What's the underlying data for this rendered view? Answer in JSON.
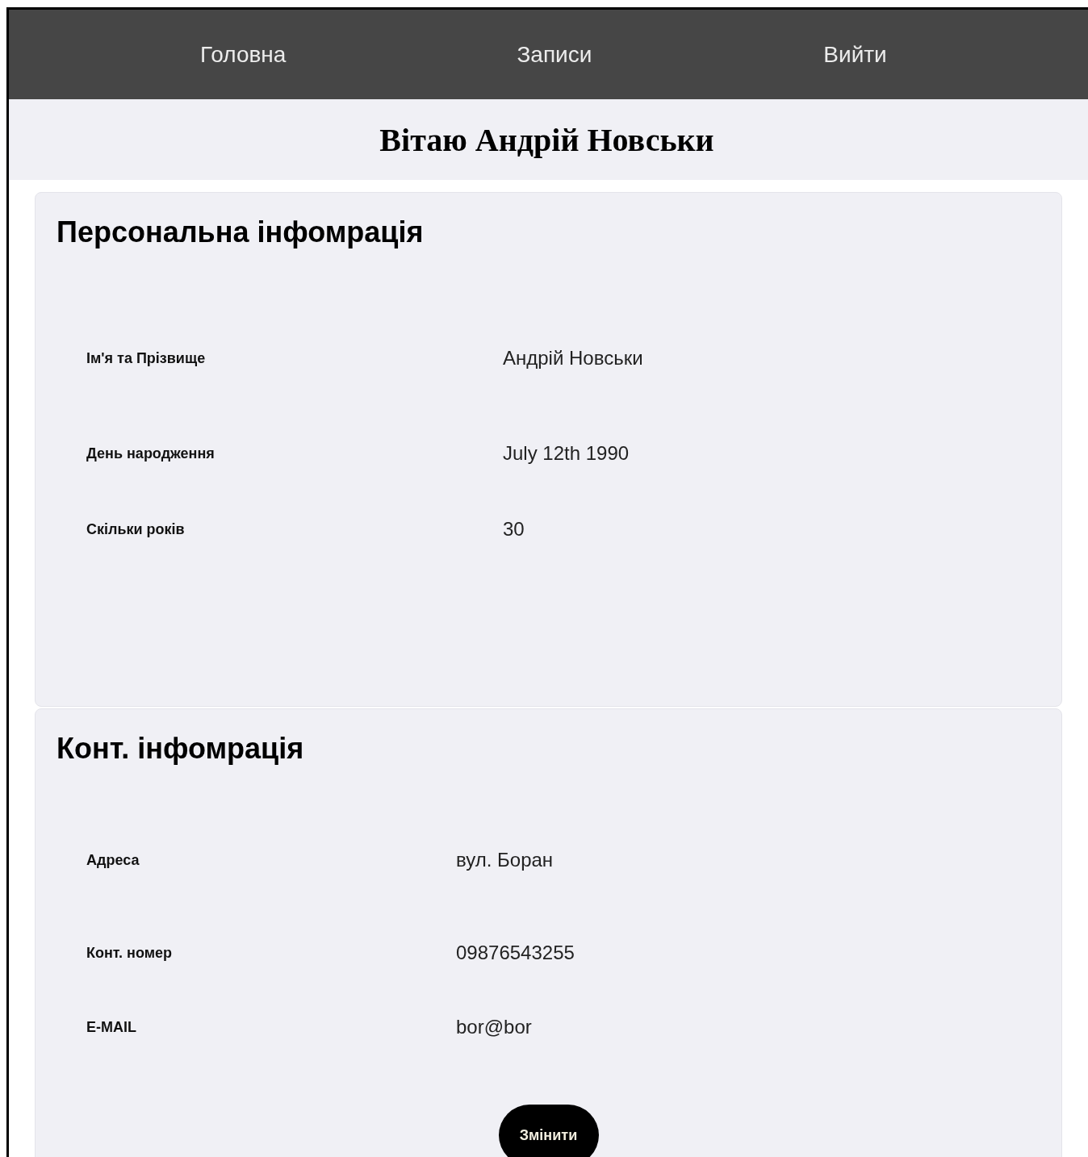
{
  "nav": {
    "items": [
      {
        "label": "Головна"
      },
      {
        "label": "Записи"
      },
      {
        "label": "Вийти"
      }
    ]
  },
  "greeting": "Вітаю Андрій Новськи",
  "sections": [
    {
      "title": "Персональна інфомрація",
      "rows": [
        {
          "label": "Ім'я та Прізвище",
          "value": "Андрій Новськи"
        },
        {
          "label": "День народження",
          "value": "July 12th 1990"
        },
        {
          "label": "Скільки років",
          "value": "30"
        }
      ]
    },
    {
      "title": "Конт. інфомрація",
      "rows": [
        {
          "label": "Адреса",
          "value": "вул. Боран"
        },
        {
          "label": "Конт. номер",
          "value": "09876543255"
        },
        {
          "label": "E-MAIL",
          "value": "bor@bor"
        }
      ],
      "button": "Змінити"
    }
  ]
}
